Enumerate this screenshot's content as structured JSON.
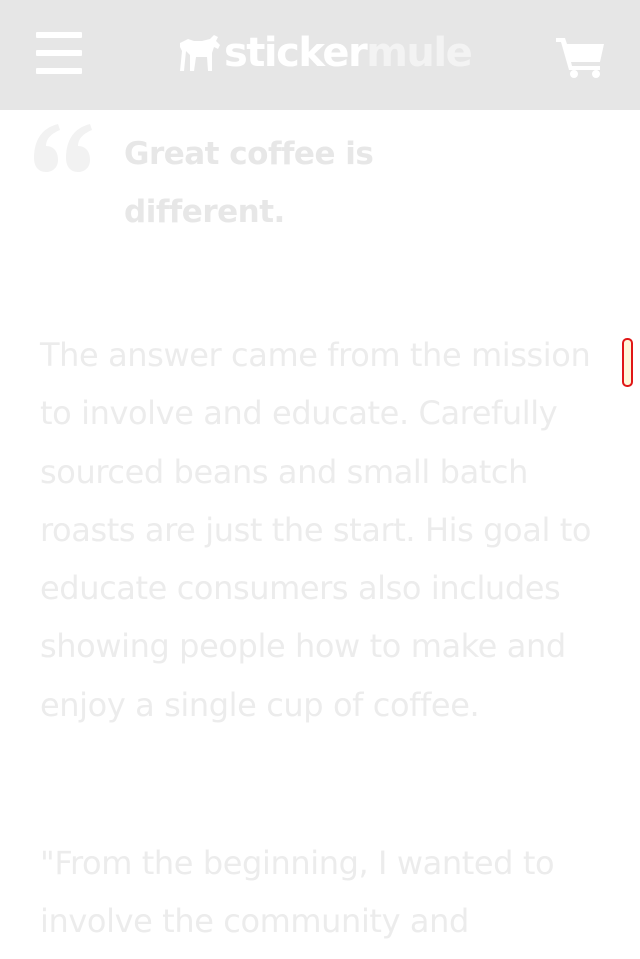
{
  "header": {
    "menu_icon": "hamburger-menu-icon",
    "logo": {
      "icon": "mule-icon",
      "text_primary": "sticker",
      "text_secondary": "mule"
    },
    "cart_icon": "shopping-cart-icon"
  },
  "article": {
    "quote_icon": "quote-mark-icon",
    "pull_quote": "Great coffee is different.",
    "paragraphs": [
      "The answer came from the mission to involve and educate. Carefully sourced beans and small batch roasts are just the start. His goal to educate consumers also includes showing people how to make and enjoy a single cup of coffee.",
      "\"From the beginning, I wanted to involve the community and"
    ]
  },
  "colors": {
    "header_bg": "#e6e6e6",
    "text_faded": "#ececec",
    "scrollbar_border": "#e01717"
  }
}
